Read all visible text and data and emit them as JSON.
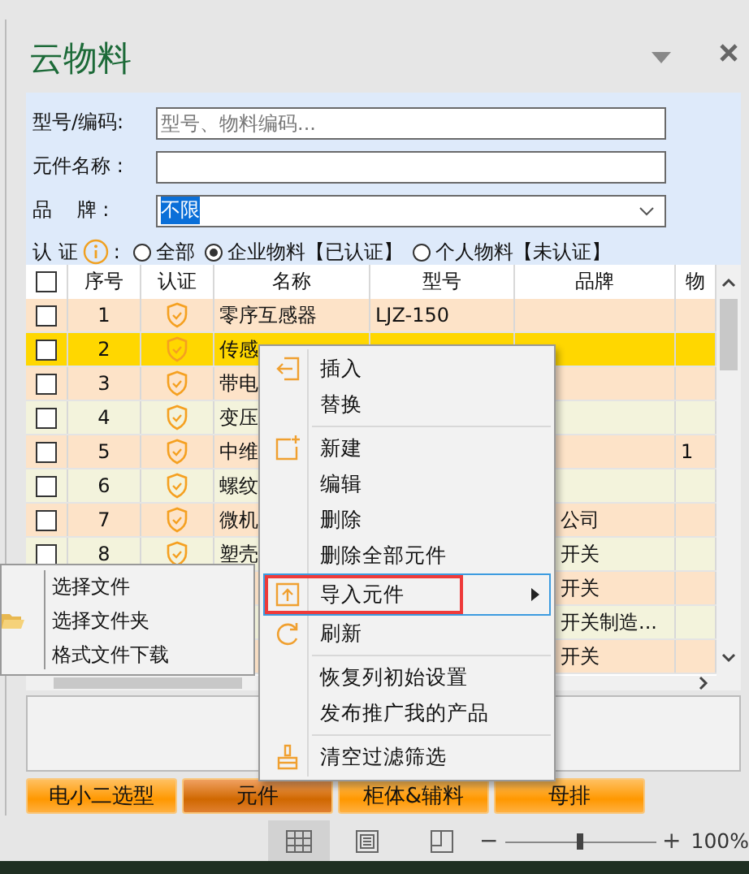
{
  "title": "云物料",
  "form": {
    "fields": [
      {
        "kind": "text",
        "label": "型号/编码:",
        "placeholder": "型号、物料编码..."
      },
      {
        "kind": "text",
        "label": "元件名称 :"
      },
      {
        "kind": "select",
        "label": "品    牌 :",
        "value": "不限"
      }
    ],
    "certification": {
      "label": "认 证",
      "colon": ":",
      "options": [
        {
          "label": "全部",
          "selected": false
        },
        {
          "label": "企业物料【已认证】",
          "selected": true
        },
        {
          "label": "个人物料【未认证】",
          "selected": false
        }
      ]
    }
  },
  "table": {
    "select_all_checked": false,
    "columns": [
      "序号",
      "认证",
      "名称",
      "型号",
      "品牌",
      "物"
    ],
    "rows": [
      {
        "checked": false,
        "certified": true,
        "num": "1",
        "name": "零序互感器",
        "model": "LJZ-150",
        "selected": false
      },
      {
        "checked": false,
        "certified": true,
        "num": "2",
        "name": "传感",
        "selected": true
      },
      {
        "checked": false,
        "certified": true,
        "num": "3",
        "name": "带电",
        "selected": false
      },
      {
        "checked": false,
        "certified": true,
        "num": "4",
        "name": "变压",
        "selected": false
      },
      {
        "checked": false,
        "certified": true,
        "num": "5",
        "name": "中维",
        "col6": "1",
        "selected": false
      },
      {
        "checked": false,
        "certified": true,
        "num": "6",
        "name": "螺纹",
        "selected": false
      },
      {
        "checked": false,
        "certified": true,
        "num": "7",
        "name": "微机",
        "brand": "公司",
        "selected": false
      },
      {
        "checked": false,
        "certified": true,
        "num": "8",
        "name": "塑壳",
        "brand": "开关",
        "selected": false
      },
      {
        "brand": "开关",
        "selected": false
      },
      {
        "brand": "开关制造...",
        "selected": false
      },
      {
        "brand": "开关",
        "selected": false
      }
    ]
  },
  "tabs": [
    {
      "label": "电小二选型",
      "selected": false
    },
    {
      "label": "元件",
      "selected": true
    },
    {
      "label": "柜体&辅料",
      "selected": false
    },
    {
      "label": "母排",
      "selected": false
    }
  ],
  "status_bar": {
    "views": [
      {
        "kind": "grid",
        "selected": true
      },
      {
        "kind": "page",
        "selected": false
      },
      {
        "kind": "page-break",
        "selected": false
      }
    ],
    "zoom": {
      "minus": "−",
      "plus": "+",
      "level": 0.5,
      "reading": "100%"
    }
  },
  "context_menu": {
    "items": [
      {
        "kind": "item",
        "label": "插入"
      },
      {
        "kind": "item",
        "label": "替换"
      },
      {
        "kind": "separator"
      },
      {
        "kind": "item",
        "label": "新建"
      },
      {
        "kind": "item",
        "label": "编辑"
      },
      {
        "kind": "item",
        "label": "删除"
      },
      {
        "kind": "item",
        "label": "删除全部元件"
      },
      {
        "kind": "item",
        "label": "导入元件",
        "highlighted": true,
        "submenu": true,
        "marked": true
      },
      {
        "kind": "item",
        "label": "刷新"
      },
      {
        "kind": "separator"
      },
      {
        "kind": "item",
        "label": "恢复列初始设置"
      },
      {
        "kind": "item",
        "label": "发布推广我的产品"
      },
      {
        "kind": "separator"
      },
      {
        "kind": "item",
        "label": "清空过滤筛选"
      }
    ]
  },
  "submenu": {
    "items": [
      {
        "label": "选择文件"
      },
      {
        "label": "选择文件夹"
      },
      {
        "label": "格式文件下载"
      }
    ]
  }
}
